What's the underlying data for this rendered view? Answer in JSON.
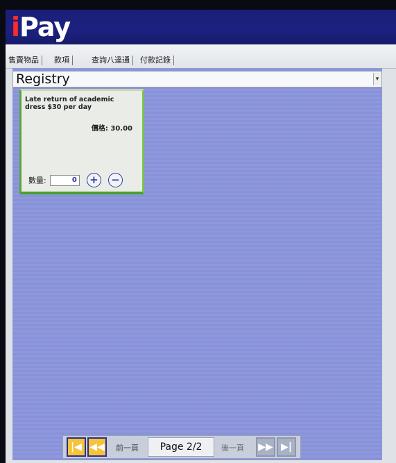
{
  "app": {
    "logo_i": "i",
    "logo_rest": "Pay"
  },
  "tabs": [
    {
      "label": "售賣物品"
    },
    {
      "label": "款項"
    },
    {
      "label": "查詢八達通"
    },
    {
      "label": "付款記錄"
    }
  ],
  "category": {
    "selected": "Registry"
  },
  "items": [
    {
      "title": "Late return of academic dress $30 per day",
      "price_label": "價格:",
      "price": "30.00",
      "qty_label": "數量:",
      "qty": "0",
      "plus_icon": "plus-circle-icon",
      "minus_icon": "minus-circle-icon"
    }
  ],
  "pager": {
    "prev_label": "前一頁",
    "page_text": "Page 2/2",
    "next_label": "後一頁",
    "first_icon": "first-page-icon",
    "prev_icon": "previous-page-icon",
    "next_icon": "next-page-icon",
    "last_icon": "last-page-icon"
  },
  "colors": {
    "header": "#1c2180",
    "content": "#8b95dc",
    "card_border": "#48a22a",
    "pager_button": "#f6c43a"
  }
}
